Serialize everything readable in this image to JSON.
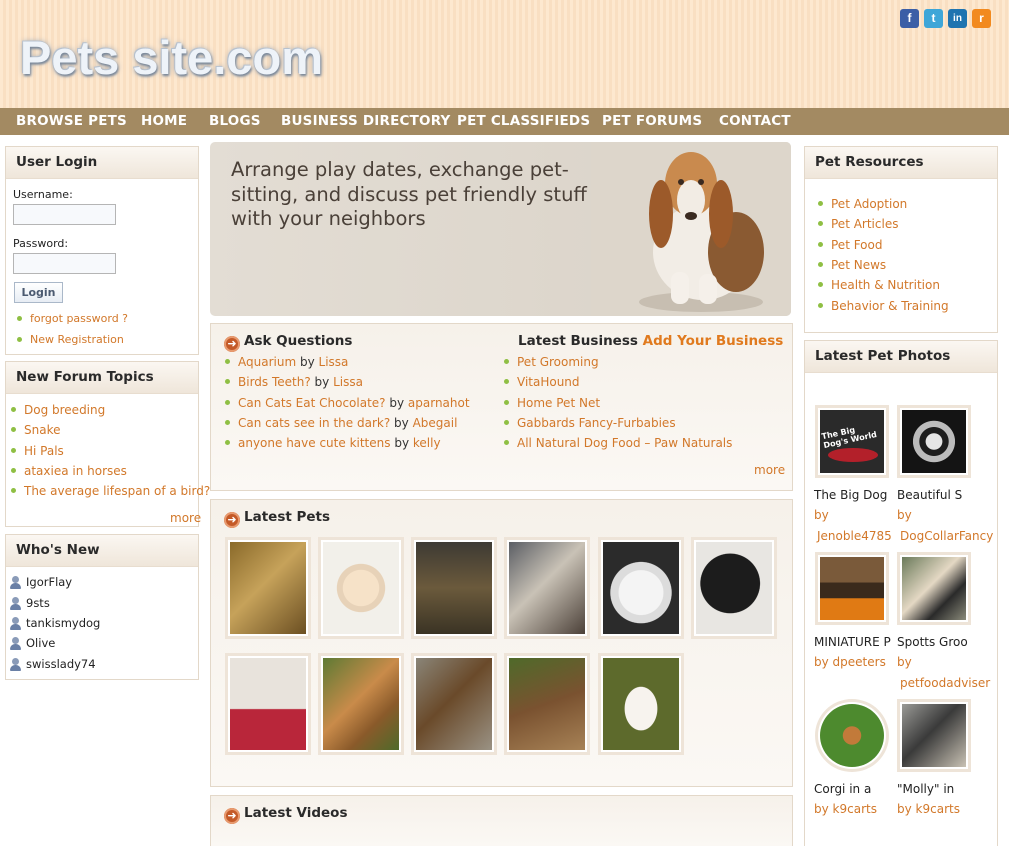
{
  "header": {
    "logo": "Pets site.com",
    "social": {
      "facebook": "f",
      "twitter": "t",
      "linkedin": "in",
      "rss": "r"
    }
  },
  "nav": [
    "BROWSE PETS",
    "HOME",
    "BLOGS",
    "BUSINESS DIRECTORY",
    "PET CLASSIFIEDS",
    "PET FORUMS",
    "CONTACT"
  ],
  "login": {
    "title": "User Login",
    "username_label": "Username:",
    "password_label": "Password:",
    "button": "Login",
    "links": [
      "forgot password ?",
      "New Registration"
    ]
  },
  "forum": {
    "title": "New Forum Topics",
    "topics": [
      "Dog breeding",
      "Snake",
      "Hi Pals",
      "ataxiea in horses",
      "The average lifespan of a bird?"
    ],
    "more": "more"
  },
  "whos_new": {
    "title": "Who's New",
    "users": [
      "IgorFlay",
      "9sts",
      "tankismydog",
      "Olive",
      "swisslady74"
    ]
  },
  "banner": {
    "text": "Arrange play dates, exchange pet-sitting, and discuss pet friendly stuff with your neighbors"
  },
  "ask": {
    "title": "Ask Questions",
    "by": "by",
    "items": [
      {
        "q": "Aquarium",
        "user": "Lissa"
      },
      {
        "q": "Birds Teeth?",
        "user": "Lissa"
      },
      {
        "q": "Can Cats Eat Chocolate?",
        "user": "aparnahot"
      },
      {
        "q": "Can cats see in the dark?",
        "user": "Abegail"
      },
      {
        "q": "anyone have cute kittens",
        "user": "kelly"
      }
    ]
  },
  "business": {
    "title": "Latest Business",
    "add": "Add Your Business",
    "items": [
      "Pet Grooming",
      "VitaHound",
      "Home Pet Net",
      "Gabbards Fancy-Furbabies",
      "All Natural Dog Food – Paw Naturals"
    ],
    "more": "more"
  },
  "latest_pets": {
    "title": "Latest Pets"
  },
  "latest_videos": {
    "title": "Latest Videos"
  },
  "resources": {
    "title": "Pet Resources",
    "items": [
      "Pet Adoption",
      "Pet Articles",
      "Pet Food",
      "Pet News",
      "Health & Nutrition",
      "Behavior & Training"
    ]
  },
  "photos": {
    "title": "Latest Pet Photos",
    "items": [
      {
        "name": "The Big Dog",
        "by": "by",
        "user": "Jenoble4785",
        "img_text": "The Big Dog's World"
      },
      {
        "name": "Beautiful S",
        "by": "by",
        "user": "DogCollarFancy"
      },
      {
        "name": "MINIATURE P",
        "by": "by",
        "user": "dpeeters"
      },
      {
        "name": "Spotts Groo",
        "by": "by",
        "user": "petfoodadviser"
      },
      {
        "name": "Corgi in a",
        "by": "by",
        "user": "k9carts"
      },
      {
        "name": "\"Molly\" in",
        "by": "by",
        "user": "k9carts"
      }
    ]
  }
}
